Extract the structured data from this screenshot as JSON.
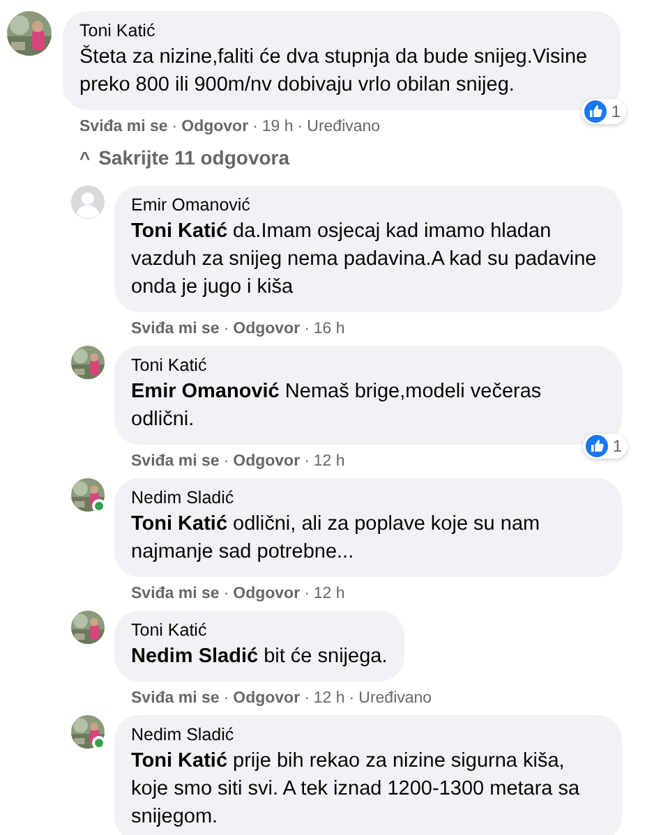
{
  "comment": {
    "author": "Toni Katić",
    "online": false,
    "text": "Šteta za nizine,faliti će dva stupnja da bude snijeg.Visine preko 800 ili 900m/nv dobivaju vrlo obilan snijeg.",
    "reaction_count": "1",
    "meta": [
      {
        "kind": "link",
        "text": "Sviđa mi se"
      },
      {
        "kind": "sep",
        "text": "·"
      },
      {
        "kind": "link",
        "text": "Odgovor"
      },
      {
        "kind": "sep",
        "text": "·"
      },
      {
        "kind": "info",
        "text": "19 h"
      },
      {
        "kind": "sep",
        "text": "·"
      },
      {
        "kind": "info",
        "text": "Uređivano"
      }
    ]
  },
  "toggle": {
    "icon": "^",
    "label": "Sakrijte 11 odgovora",
    "expanded": true
  },
  "replies": [
    {
      "author": "Emir Omanović",
      "avatar": {
        "kind": "default"
      },
      "online": false,
      "text": "**Toni Katić** da.Imam osjecaj kad imamo hladan vazduh za snijeg nema padavina.A kad su padavine onda je jugo i kiša",
      "meta": [
        {
          "kind": "link",
          "text": "Sviđa mi se"
        },
        {
          "kind": "sep",
          "text": "·"
        },
        {
          "kind": "link",
          "text": "Odgovor"
        },
        {
          "kind": "sep",
          "text": "·"
        },
        {
          "kind": "info",
          "text": "16 h"
        }
      ]
    },
    {
      "author": "Toni Katić",
      "online": false,
      "text": "**Emir Omanović** Nemaš brige,modeli večeras odlični.",
      "reaction_count": "1",
      "meta": [
        {
          "kind": "link",
          "text": "Sviđa mi se"
        },
        {
          "kind": "sep",
          "text": "·"
        },
        {
          "kind": "link",
          "text": "Odgovor"
        },
        {
          "kind": "sep",
          "text": "·"
        },
        {
          "kind": "info",
          "text": "12 h"
        }
      ]
    },
    {
      "author": "Nedim Sladić",
      "online": true,
      "text": "**Toni Katić** odlični, ali za poplave koje su nam najmanje sad potrebne...",
      "meta": [
        {
          "kind": "link",
          "text": "Sviđa mi se"
        },
        {
          "kind": "sep",
          "text": "·"
        },
        {
          "kind": "link",
          "text": "Odgovor"
        },
        {
          "kind": "sep",
          "text": "·"
        },
        {
          "kind": "info",
          "text": "12 h"
        }
      ]
    },
    {
      "author": "Toni Katić",
      "online": false,
      "text": "**Nedim Sladić** bit će snijega.",
      "meta": [
        {
          "kind": "link",
          "text": "Sviđa mi se"
        },
        {
          "kind": "sep",
          "text": "·"
        },
        {
          "kind": "link",
          "text": "Odgovor"
        },
        {
          "kind": "sep",
          "text": "·"
        },
        {
          "kind": "info",
          "text": "12 h"
        },
        {
          "kind": "sep",
          "text": "·"
        },
        {
          "kind": "info",
          "text": "Uređivano"
        }
      ]
    },
    {
      "author": "Nedim Sladić",
      "online": true,
      "text": "**Toni Katić** prije bih rekao za nizine sigurna kiša, koje smo siti svi. A tek iznad 1200-1300 metara sa snijegom."
    }
  ]
}
